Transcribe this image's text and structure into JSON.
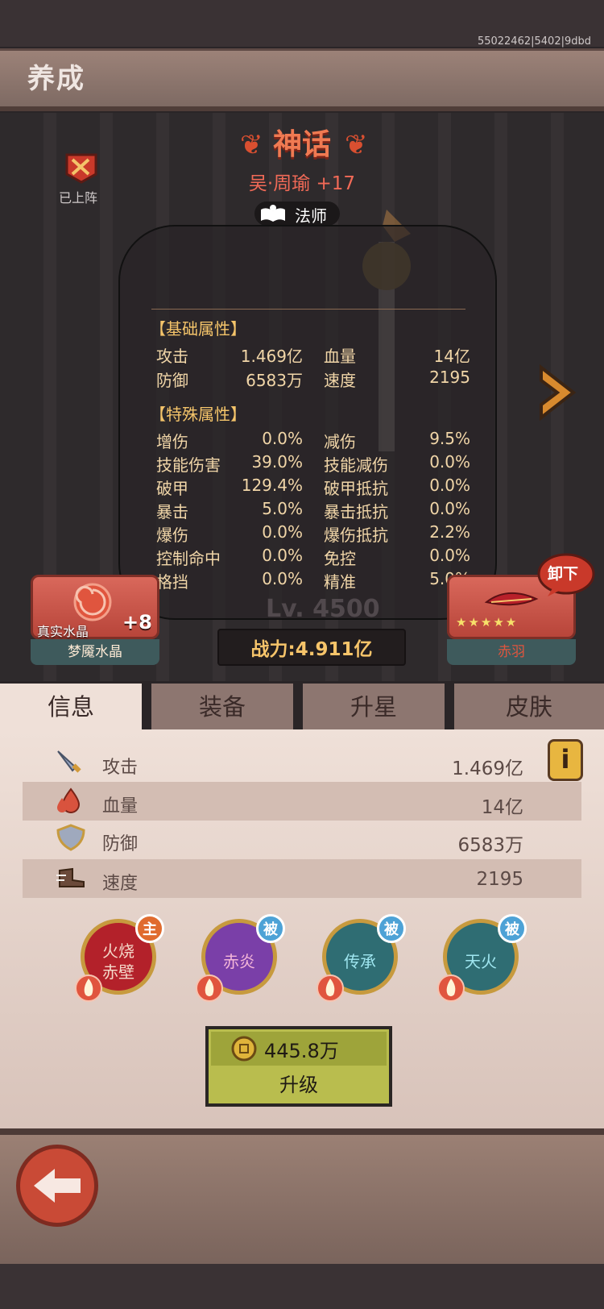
{
  "build_id": "55022462|5402|9dbd",
  "header": {
    "title": "养成"
  },
  "hero": {
    "rarity": "神话",
    "name": "吴·周瑜 +17",
    "class": "法师",
    "deployed_label": "已上阵",
    "level": "Lv. 4500",
    "power": "战力:4.911亿"
  },
  "stats_panel": {
    "base_title": "【基础属性】",
    "base": [
      {
        "label": "攻击",
        "value": "1.469亿",
        "label2": "血量",
        "value2": "14亿"
      },
      {
        "label": "防御",
        "value": "6583万",
        "label2": "速度",
        "value2": "2195"
      }
    ],
    "special_title": "【特殊属性】",
    "special": [
      {
        "label": "增伤",
        "value": "0.0%",
        "label2": "减伤",
        "value2": "9.5%"
      },
      {
        "label": "技能伤害",
        "value": "39.0%",
        "label2": "技能减伤",
        "value2": "0.0%"
      },
      {
        "label": "破甲",
        "value": "129.4%",
        "label2": "破甲抵抗",
        "value2": "0.0%"
      },
      {
        "label": "暴击",
        "value": "5.0%",
        "label2": "暴击抵抗",
        "value2": "0.0%"
      },
      {
        "label": "爆伤",
        "value": "0.0%",
        "label2": "爆伤抵抗",
        "value2": "2.2%"
      },
      {
        "label": "控制命中",
        "value": "0.0%",
        "label2": "免控",
        "value2": "0.0%"
      },
      {
        "label": "格挡",
        "value": "0.0%",
        "label2": "精准",
        "value2": "5.0%"
      }
    ]
  },
  "left_card": {
    "tag": "真实水晶",
    "plus": "+8",
    "name": "梦魇水晶"
  },
  "right_card": {
    "name": "赤羽",
    "stars": 5,
    "unequip": "卸下"
  },
  "tabs": [
    "信息",
    "装备",
    "升星",
    "皮肤"
  ],
  "info_rows": [
    {
      "label": "攻击",
      "value": "1.469亿",
      "icon": "sword-icon"
    },
    {
      "label": "血量",
      "value": "14亿",
      "icon": "blood-icon"
    },
    {
      "label": "防御",
      "value": "6583万",
      "icon": "shield-icon"
    },
    {
      "label": "速度",
      "value": "2195",
      "icon": "boot-icon"
    }
  ],
  "info_button": "i",
  "skills": [
    {
      "name": "火烧赤壁",
      "line1": "火烧",
      "line2": "赤壁",
      "badge": "主",
      "bg": "#b3212a",
      "text": "#f4d7c8",
      "badge_bg": "#e06b2e"
    },
    {
      "name": "赤炎",
      "line1": "赤炎",
      "line2": "",
      "badge": "被",
      "bg": "#7a3fa8",
      "text": "#f4b6d8",
      "badge_bg": "#4da2d6"
    },
    {
      "name": "传承",
      "line1": "传承",
      "line2": "",
      "badge": "被",
      "bg": "#2f6d73",
      "text": "#9fe6f0",
      "badge_bg": "#4da2d6"
    },
    {
      "name": "天火",
      "line1": "天火",
      "line2": "",
      "badge": "被",
      "bg": "#2f6d73",
      "text": "#9fe6f0",
      "badge_bg": "#4da2d6"
    }
  ],
  "upgrade": {
    "cost": "445.8万",
    "label": "升级"
  },
  "colors": {
    "accent_orange": "#f4c46a",
    "plank": "#8d7670",
    "tab_active": "#efe0d8"
  }
}
